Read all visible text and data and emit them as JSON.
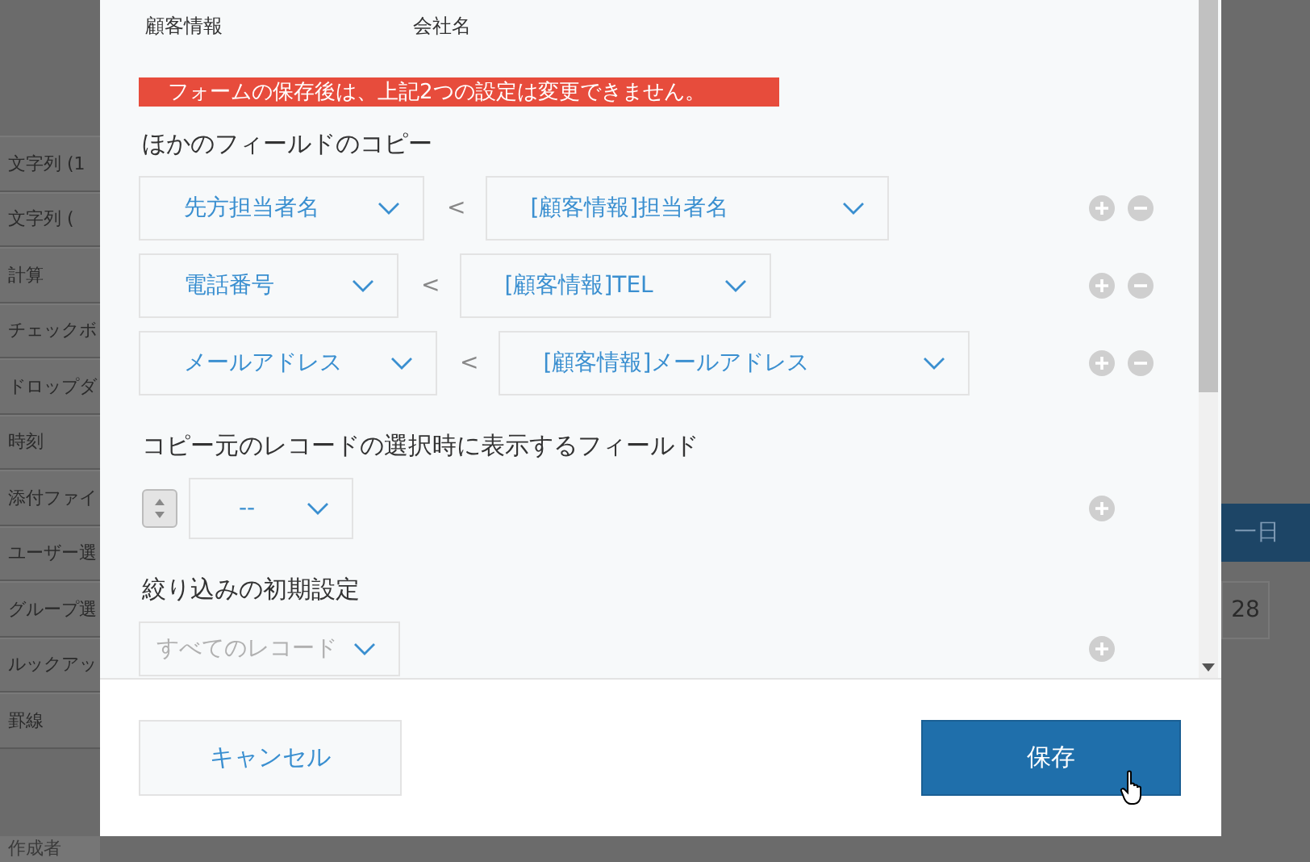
{
  "background": {
    "sidebar_items": [
      "文字列 (1",
      "文字列 (",
      "計算",
      "チェックボ",
      "ドロップダ",
      "時刻",
      "添付ファイ",
      "ユーザー選",
      "グループ選",
      "ルックアッ",
      "罫線"
    ],
    "sidebar_footer": "作成者",
    "header_tab": "一日",
    "date_cell": "28"
  },
  "dialog": {
    "header_labels": [
      "顧客情報",
      "会社名"
    ],
    "warning": "フォームの保存後は、上記2つの設定は変更できません。",
    "field_copy": {
      "title": "ほかのフィールドのコピー",
      "rows": [
        {
          "target": "先方担当者名",
          "arrow": "<",
          "source": "[顧客情報]担当者名"
        },
        {
          "target": "電話番号",
          "arrow": "<",
          "source": "[顧客情報]TEL"
        },
        {
          "target": "メールアドレス",
          "arrow": "<",
          "source": "[顧客情報]メールアドレス"
        }
      ]
    },
    "display_fields": {
      "title": "コピー元のレコードの選択時に表示するフィールド",
      "rows": [
        {
          "value": "--"
        }
      ]
    },
    "filter": {
      "title": "絞り込みの初期設定",
      "value": "すべてのレコード"
    },
    "buttons": [
      {
        "label": "キャンセル",
        "kind": "secondary"
      },
      {
        "label": "保存",
        "kind": "primary"
      }
    ]
  }
}
